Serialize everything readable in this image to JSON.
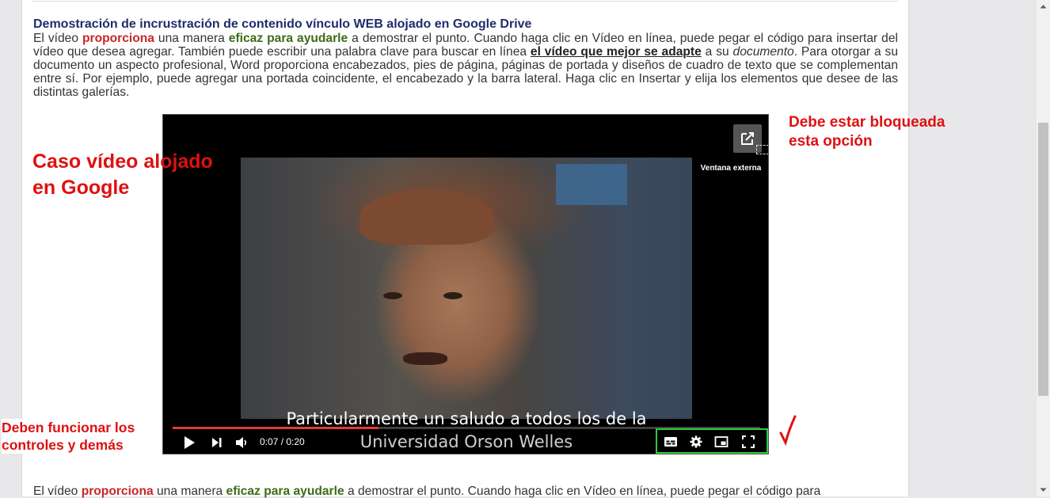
{
  "article": {
    "heading": "Demostración de incrustración de contenido vínculo WEB alojado en Google Drive",
    "p1": {
      "t1": "El vídeo ",
      "red": "proporciona",
      "t2": " una manera ",
      "green": "eficaz para ayudarle",
      "t3": " a demostrar el punto. Cuando haga clic en Vídeo en línea, puede pegar el código para insertar del vídeo que desea agregar. También puede escribir una palabra clave para buscar en línea ",
      "underline": "el vídeo que mejor se adapte",
      "t4": " a su ",
      "italic": "documento",
      "t5": ". Para otorgar a su documento un aspecto profesional, Word proporciona encabezados, pies de página, páginas de portada y diseños de cuadro de texto que se complementan entre sí. Por ejemplo, puede agregar una portada coincidente, el encabezado y la barra lateral. Haga clic en Insertar y elija los elementos que desee de las distintas galerías."
    },
    "p2": {
      "t1": "El vídeo ",
      "red": "proporciona",
      "t2": " una manera ",
      "green": "eficaz para ayudarle",
      "t3": " a demostrar el punto. Cuando haga clic en Vídeo en línea, puede pegar el código para"
    }
  },
  "annotations": {
    "left": "Caso vídeo alojado en Google",
    "right": "Debe estar bloqueada esta opción",
    "bottom": "Deben funcionar los controles y demás"
  },
  "video": {
    "external_label": "Ventana externa",
    "subtitle_line1": "Particularmente un saludo a todos los de la",
    "subtitle_line2": "Universidad Orson Welles",
    "time": "0:07 / 0:20",
    "progress": 0.35
  },
  "colors": {
    "annotation": "#e01010",
    "progress": "#e53935",
    "highlight_box": "#2ecc40"
  },
  "icons": [
    "open-external-icon",
    "play-icon",
    "next-icon",
    "volume-icon",
    "captions-icon",
    "gear-icon",
    "miniplayer-icon",
    "fullscreen-icon",
    "checkmark-icon",
    "scroll-up-icon",
    "scroll-down-icon"
  ]
}
